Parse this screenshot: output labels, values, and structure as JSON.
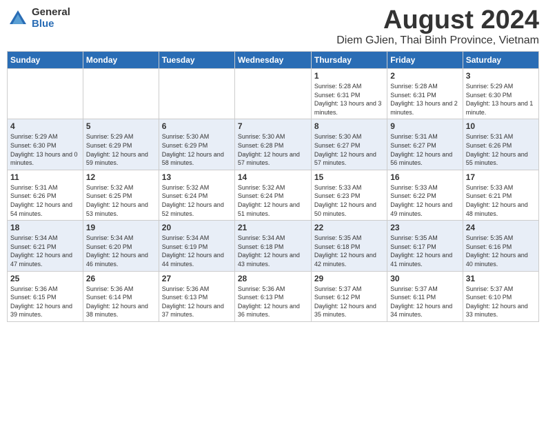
{
  "logo": {
    "general": "General",
    "blue": "Blue"
  },
  "header": {
    "month_year": "August 2024",
    "location": "Diem GJien, Thai Binh Province, Vietnam"
  },
  "weekdays": [
    "Sunday",
    "Monday",
    "Tuesday",
    "Wednesday",
    "Thursday",
    "Friday",
    "Saturday"
  ],
  "weeks": [
    [
      {
        "day": "",
        "sunrise": "",
        "sunset": "",
        "daylight": ""
      },
      {
        "day": "",
        "sunrise": "",
        "sunset": "",
        "daylight": ""
      },
      {
        "day": "",
        "sunrise": "",
        "sunset": "",
        "daylight": ""
      },
      {
        "day": "",
        "sunrise": "",
        "sunset": "",
        "daylight": ""
      },
      {
        "day": "1",
        "sunrise": "Sunrise: 5:28 AM",
        "sunset": "Sunset: 6:31 PM",
        "daylight": "Daylight: 13 hours and 3 minutes."
      },
      {
        "day": "2",
        "sunrise": "Sunrise: 5:28 AM",
        "sunset": "Sunset: 6:31 PM",
        "daylight": "Daylight: 13 hours and 2 minutes."
      },
      {
        "day": "3",
        "sunrise": "Sunrise: 5:29 AM",
        "sunset": "Sunset: 6:30 PM",
        "daylight": "Daylight: 13 hours and 1 minute."
      }
    ],
    [
      {
        "day": "4",
        "sunrise": "Sunrise: 5:29 AM",
        "sunset": "Sunset: 6:30 PM",
        "daylight": "Daylight: 13 hours and 0 minutes."
      },
      {
        "day": "5",
        "sunrise": "Sunrise: 5:29 AM",
        "sunset": "Sunset: 6:29 PM",
        "daylight": "Daylight: 12 hours and 59 minutes."
      },
      {
        "day": "6",
        "sunrise": "Sunrise: 5:30 AM",
        "sunset": "Sunset: 6:29 PM",
        "daylight": "Daylight: 12 hours and 58 minutes."
      },
      {
        "day": "7",
        "sunrise": "Sunrise: 5:30 AM",
        "sunset": "Sunset: 6:28 PM",
        "daylight": "Daylight: 12 hours and 57 minutes."
      },
      {
        "day": "8",
        "sunrise": "Sunrise: 5:30 AM",
        "sunset": "Sunset: 6:27 PM",
        "daylight": "Daylight: 12 hours and 57 minutes."
      },
      {
        "day": "9",
        "sunrise": "Sunrise: 5:31 AM",
        "sunset": "Sunset: 6:27 PM",
        "daylight": "Daylight: 12 hours and 56 minutes."
      },
      {
        "day": "10",
        "sunrise": "Sunrise: 5:31 AM",
        "sunset": "Sunset: 6:26 PM",
        "daylight": "Daylight: 12 hours and 55 minutes."
      }
    ],
    [
      {
        "day": "11",
        "sunrise": "Sunrise: 5:31 AM",
        "sunset": "Sunset: 6:26 PM",
        "daylight": "Daylight: 12 hours and 54 minutes."
      },
      {
        "day": "12",
        "sunrise": "Sunrise: 5:32 AM",
        "sunset": "Sunset: 6:25 PM",
        "daylight": "Daylight: 12 hours and 53 minutes."
      },
      {
        "day": "13",
        "sunrise": "Sunrise: 5:32 AM",
        "sunset": "Sunset: 6:24 PM",
        "daylight": "Daylight: 12 hours and 52 minutes."
      },
      {
        "day": "14",
        "sunrise": "Sunrise: 5:32 AM",
        "sunset": "Sunset: 6:24 PM",
        "daylight": "Daylight: 12 hours and 51 minutes."
      },
      {
        "day": "15",
        "sunrise": "Sunrise: 5:33 AM",
        "sunset": "Sunset: 6:23 PM",
        "daylight": "Daylight: 12 hours and 50 minutes."
      },
      {
        "day": "16",
        "sunrise": "Sunrise: 5:33 AM",
        "sunset": "Sunset: 6:22 PM",
        "daylight": "Daylight: 12 hours and 49 minutes."
      },
      {
        "day": "17",
        "sunrise": "Sunrise: 5:33 AM",
        "sunset": "Sunset: 6:21 PM",
        "daylight": "Daylight: 12 hours and 48 minutes."
      }
    ],
    [
      {
        "day": "18",
        "sunrise": "Sunrise: 5:34 AM",
        "sunset": "Sunset: 6:21 PM",
        "daylight": "Daylight: 12 hours and 47 minutes."
      },
      {
        "day": "19",
        "sunrise": "Sunrise: 5:34 AM",
        "sunset": "Sunset: 6:20 PM",
        "daylight": "Daylight: 12 hours and 46 minutes."
      },
      {
        "day": "20",
        "sunrise": "Sunrise: 5:34 AM",
        "sunset": "Sunset: 6:19 PM",
        "daylight": "Daylight: 12 hours and 44 minutes."
      },
      {
        "day": "21",
        "sunrise": "Sunrise: 5:34 AM",
        "sunset": "Sunset: 6:18 PM",
        "daylight": "Daylight: 12 hours and 43 minutes."
      },
      {
        "day": "22",
        "sunrise": "Sunrise: 5:35 AM",
        "sunset": "Sunset: 6:18 PM",
        "daylight": "Daylight: 12 hours and 42 minutes."
      },
      {
        "day": "23",
        "sunrise": "Sunrise: 5:35 AM",
        "sunset": "Sunset: 6:17 PM",
        "daylight": "Daylight: 12 hours and 41 minutes."
      },
      {
        "day": "24",
        "sunrise": "Sunrise: 5:35 AM",
        "sunset": "Sunset: 6:16 PM",
        "daylight": "Daylight: 12 hours and 40 minutes."
      }
    ],
    [
      {
        "day": "25",
        "sunrise": "Sunrise: 5:36 AM",
        "sunset": "Sunset: 6:15 PM",
        "daylight": "Daylight: 12 hours and 39 minutes."
      },
      {
        "day": "26",
        "sunrise": "Sunrise: 5:36 AM",
        "sunset": "Sunset: 6:14 PM",
        "daylight": "Daylight: 12 hours and 38 minutes."
      },
      {
        "day": "27",
        "sunrise": "Sunrise: 5:36 AM",
        "sunset": "Sunset: 6:13 PM",
        "daylight": "Daylight: 12 hours and 37 minutes."
      },
      {
        "day": "28",
        "sunrise": "Sunrise: 5:36 AM",
        "sunset": "Sunset: 6:13 PM",
        "daylight": "Daylight: 12 hours and 36 minutes."
      },
      {
        "day": "29",
        "sunrise": "Sunrise: 5:37 AM",
        "sunset": "Sunset: 6:12 PM",
        "daylight": "Daylight: 12 hours and 35 minutes."
      },
      {
        "day": "30",
        "sunrise": "Sunrise: 5:37 AM",
        "sunset": "Sunset: 6:11 PM",
        "daylight": "Daylight: 12 hours and 34 minutes."
      },
      {
        "day": "31",
        "sunrise": "Sunrise: 5:37 AM",
        "sunset": "Sunset: 6:10 PM",
        "daylight": "Daylight: 12 hours and 33 minutes."
      }
    ]
  ]
}
